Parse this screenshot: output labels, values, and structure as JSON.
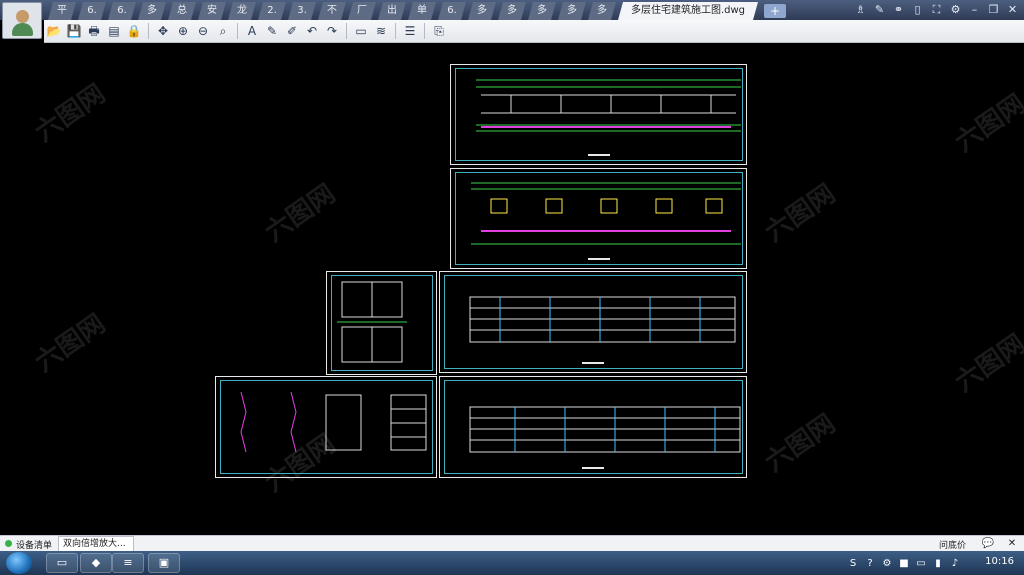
{
  "titlebar": {
    "tabs": [
      "平",
      "6.",
      "6.",
      "多",
      "总",
      "安",
      "龙",
      "2.",
      "3.",
      "不",
      "厂",
      "出",
      "单",
      "6.",
      "多",
      "多",
      "多",
      "多",
      "多"
    ],
    "active_tab": "多层住宅建筑施工图.dwg",
    "new_tab": "+",
    "controls": [
      "♗",
      "✎",
      "⚭",
      "▯",
      "⛶",
      "⚙",
      "–",
      "❐",
      "✕"
    ]
  },
  "toolbar": {
    "buttons": [
      {
        "name": "open-icon",
        "glyph": "📂"
      },
      {
        "name": "save-icon",
        "glyph": "💾"
      },
      {
        "name": "print-icon",
        "glyph": "🖶"
      },
      {
        "name": "pdf-icon",
        "glyph": "▤"
      },
      {
        "name": "lock-icon",
        "glyph": "🔒"
      },
      {
        "name": "pan-icon",
        "glyph": "✥"
      },
      {
        "name": "zoom-in-icon",
        "glyph": "⊕"
      },
      {
        "name": "zoom-out-icon",
        "glyph": "⊖"
      },
      {
        "name": "zoom-window-icon",
        "glyph": "⌕"
      },
      {
        "name": "text-icon",
        "glyph": "A"
      },
      {
        "name": "pencil-icon",
        "glyph": "✎"
      },
      {
        "name": "highlight-icon",
        "glyph": "✐"
      },
      {
        "name": "undo-icon",
        "glyph": "↶"
      },
      {
        "name": "redo-icon",
        "glyph": "↷"
      },
      {
        "name": "measure-icon",
        "glyph": "▭"
      },
      {
        "name": "dimension-icon",
        "glyph": "≋"
      },
      {
        "name": "layers-icon",
        "glyph": "☰"
      },
      {
        "name": "export-icon",
        "glyph": "⎘"
      }
    ]
  },
  "statusbar": {
    "device_list": "设备清单",
    "hint": "双向倍增放大...",
    "help": "问底价"
  },
  "taskbar": {
    "clock": "10:16"
  },
  "canvas": {
    "watermark": "六图网"
  }
}
